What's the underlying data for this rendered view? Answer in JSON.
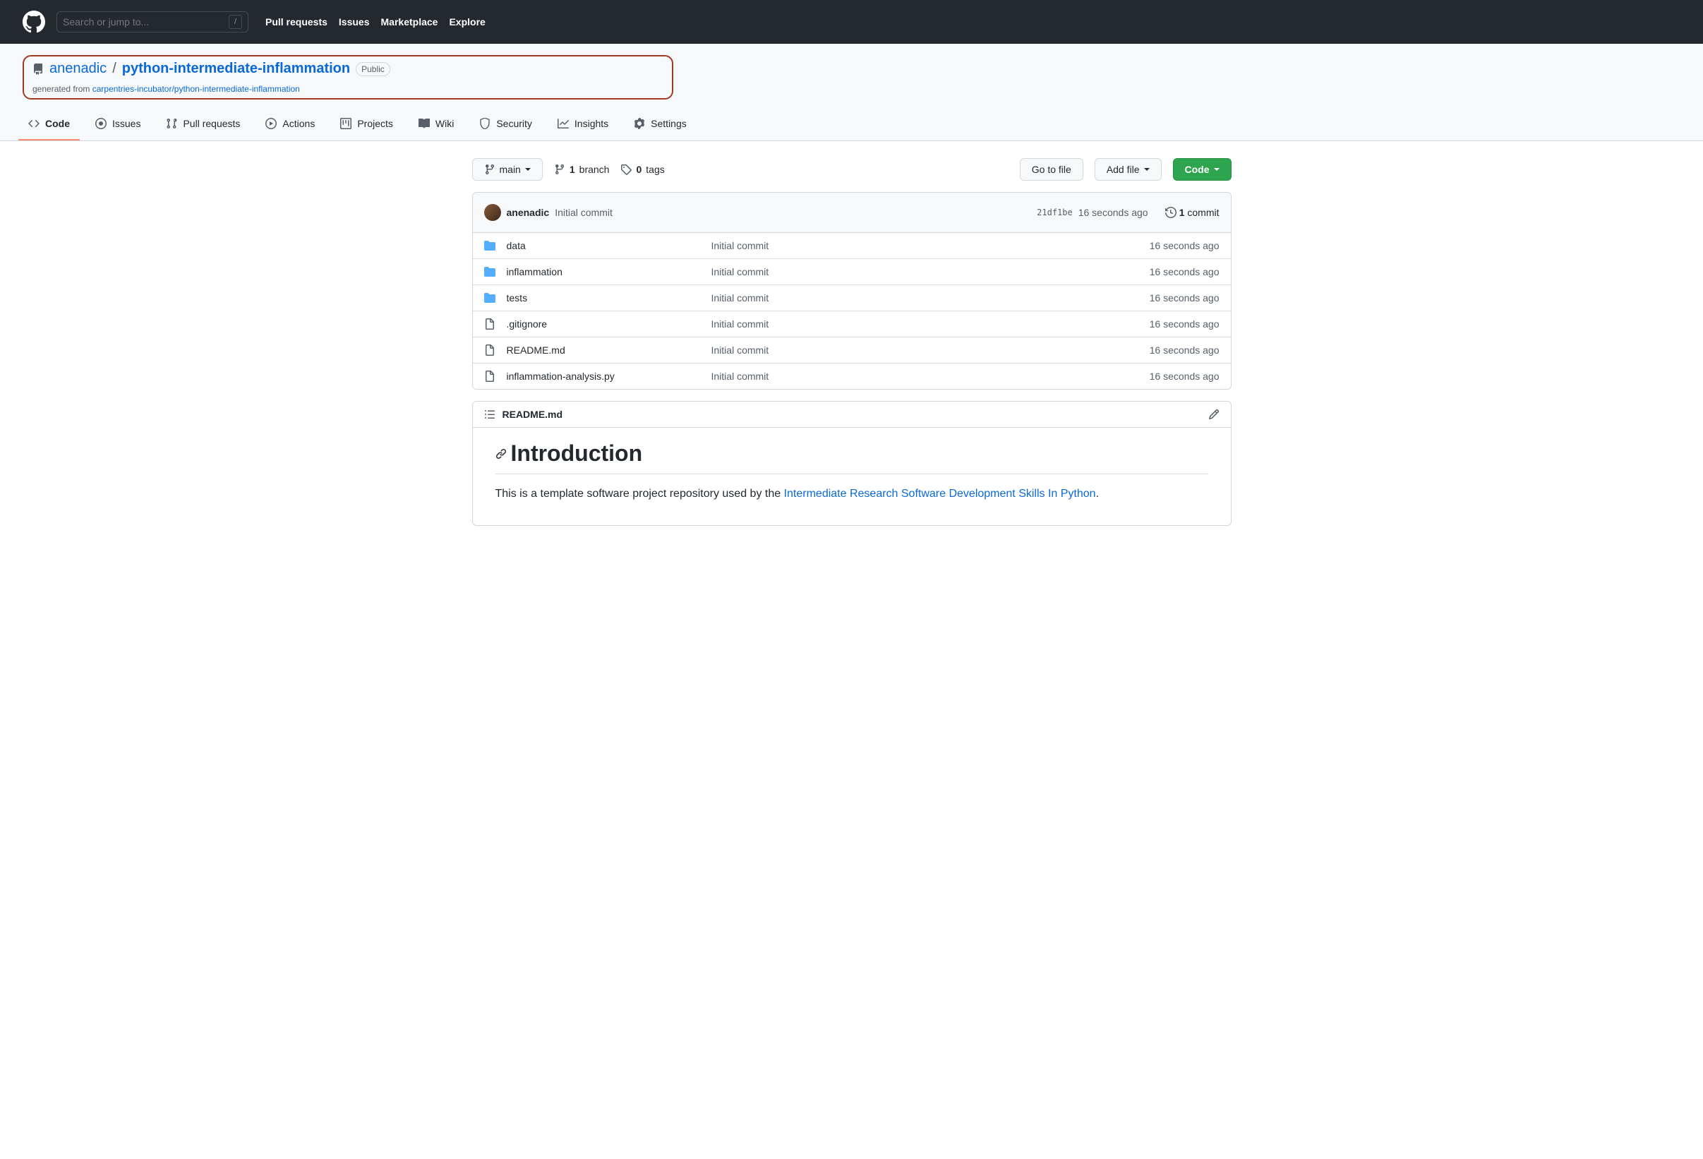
{
  "header": {
    "search_placeholder": "Search or jump to...",
    "slash": "/",
    "nav": [
      "Pull requests",
      "Issues",
      "Marketplace",
      "Explore"
    ]
  },
  "repo": {
    "owner": "anenadic",
    "name": "python-intermediate-inflammation",
    "visibility": "Public",
    "generated_prefix": "generated from ",
    "generated_link": "carpentries-incubator/python-intermediate-inflammation"
  },
  "tabs": [
    {
      "label": "Code"
    },
    {
      "label": "Issues"
    },
    {
      "label": "Pull requests"
    },
    {
      "label": "Actions"
    },
    {
      "label": "Projects"
    },
    {
      "label": "Wiki"
    },
    {
      "label": "Security"
    },
    {
      "label": "Insights"
    },
    {
      "label": "Settings"
    }
  ],
  "toolbar": {
    "branch_label": "main",
    "branch_count": "1",
    "branch_word": "branch",
    "tag_count": "0",
    "tag_word": "tags",
    "go_to_file": "Go to file",
    "add_file": "Add file",
    "code_btn": "Code"
  },
  "commit": {
    "author": "anenadic",
    "message": "Initial commit",
    "sha": "21df1be",
    "time": "16 seconds ago",
    "count": "1",
    "count_word": "commit"
  },
  "files": [
    {
      "type": "dir",
      "name": "data",
      "msg": "Initial commit",
      "time": "16 seconds ago"
    },
    {
      "type": "dir",
      "name": "inflammation",
      "msg": "Initial commit",
      "time": "16 seconds ago"
    },
    {
      "type": "dir",
      "name": "tests",
      "msg": "Initial commit",
      "time": "16 seconds ago"
    },
    {
      "type": "file",
      "name": ".gitignore",
      "msg": "Initial commit",
      "time": "16 seconds ago"
    },
    {
      "type": "file",
      "name": "README.md",
      "msg": "Initial commit",
      "time": "16 seconds ago"
    },
    {
      "type": "file",
      "name": "inflammation-analysis.py",
      "msg": "Initial commit",
      "time": "16 seconds ago"
    }
  ],
  "readme": {
    "filename": "README.md",
    "heading": "Introduction",
    "para_prefix": "This is a template software project repository used by the ",
    "para_link": "Intermediate Research Software Development Skills In Python",
    "para_suffix": "."
  }
}
